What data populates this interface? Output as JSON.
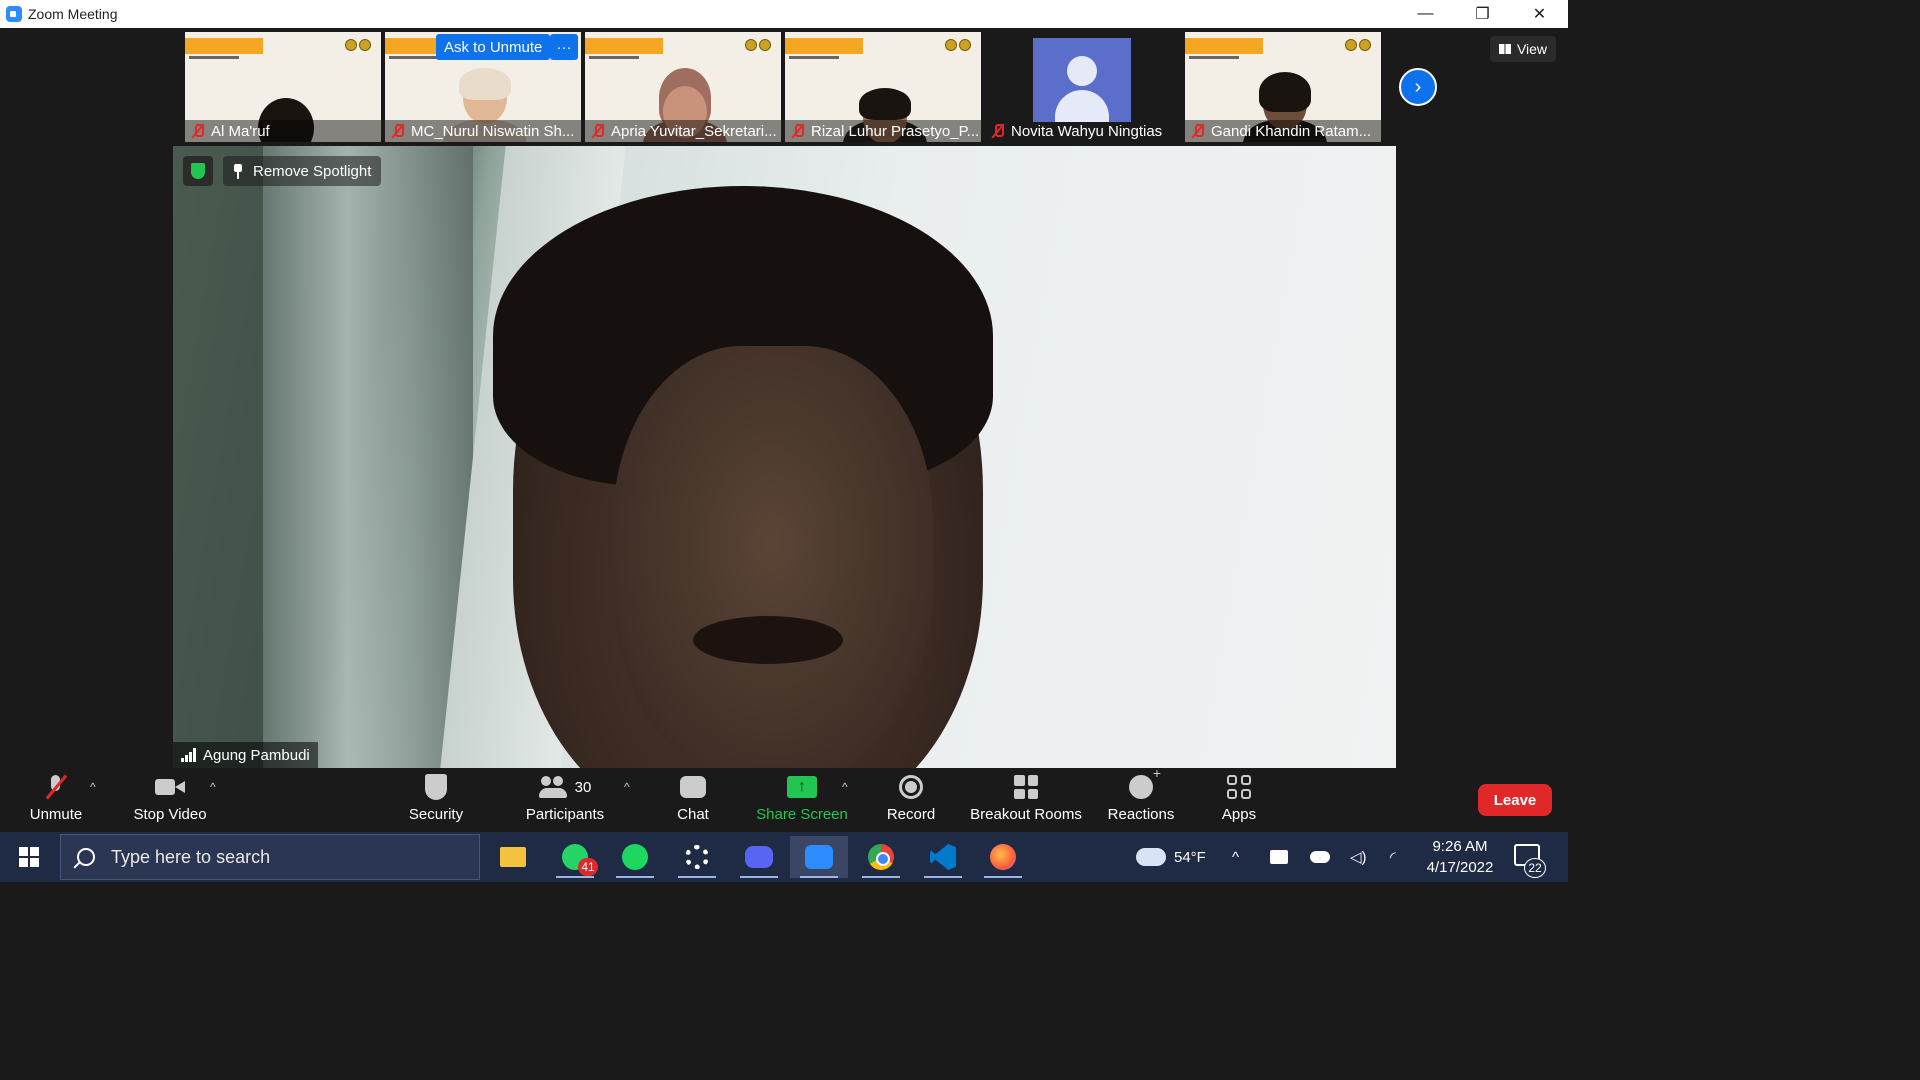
{
  "window": {
    "title": "Zoom Meeting",
    "controls": [
      "—",
      "❐",
      "✕"
    ]
  },
  "participants_strip": [
    {
      "name": "Al Ma'ruf",
      "type": "video"
    },
    {
      "name": "MC_Nurul Niswatin Sh...",
      "type": "video"
    },
    {
      "name": "Apria Yuvitar_Sekretari...",
      "type": "video"
    },
    {
      "name": "Rizal Luhur Prasetyo_P...",
      "type": "video"
    },
    {
      "name": "Novita Wahyu Ningtias",
      "type": "avatar"
    },
    {
      "name": "Gandi Khandin Ratam...",
      "type": "video"
    }
  ],
  "hover_actions": {
    "ask_unmute": "Ask to Unmute",
    "more": "···"
  },
  "view_button": "View",
  "spotlight": {
    "remove_label": "Remove Spotlight",
    "speaker_name": "Agung Pambudi"
  },
  "toolbar": {
    "unmute": "Unmute",
    "stop_video": "Stop Video",
    "security": "Security",
    "participants": "Participants",
    "participants_count": "30",
    "chat": "Chat",
    "share_screen": "Share Screen",
    "record": "Record",
    "breakout_rooms": "Breakout Rooms",
    "reactions": "Reactions",
    "apps": "Apps",
    "leave": "Leave"
  },
  "taskbar": {
    "search_placeholder": "Type here to search",
    "whatsapp_badge": "41",
    "weather": "54°F",
    "time": "9:26 AM",
    "date": "4/17/2022",
    "notifications": "22"
  },
  "colors": {
    "accent": "#0e72ed",
    "share_green": "#23c552",
    "leave_red": "#e02828",
    "taskbar": "#1f2a44"
  }
}
